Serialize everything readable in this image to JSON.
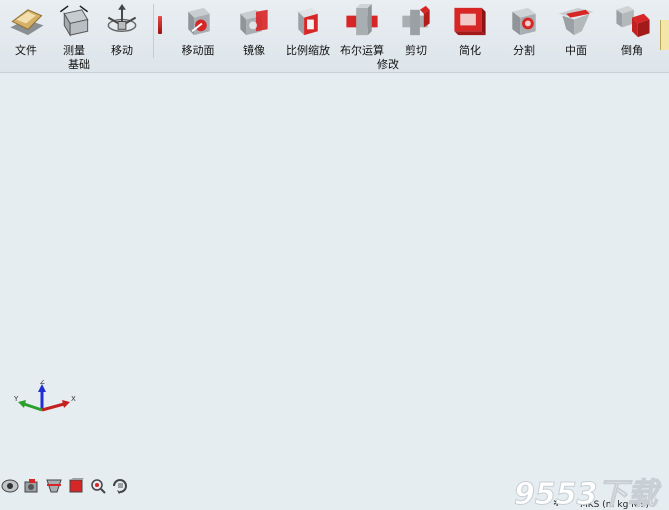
{
  "ribbon": {
    "group_basic": "基础",
    "group_modify": "修改",
    "tools_basic": [
      {
        "label": "文件",
        "icon": "file-icon"
      },
      {
        "label": "测量",
        "icon": "measure-icon"
      },
      {
        "label": "移动",
        "icon": "move-icon"
      }
    ],
    "tools_modify": [
      {
        "label": "移动面",
        "icon": "move-face-icon"
      },
      {
        "label": "镜像",
        "icon": "mirror-icon"
      },
      {
        "label": "比例缩放",
        "icon": "scale-icon"
      },
      {
        "label": "布尔运算",
        "icon": "boolean-icon"
      },
      {
        "label": "剪切",
        "icon": "cut-icon"
      },
      {
        "label": "简化",
        "icon": "simplify-icon"
      },
      {
        "label": "分割",
        "icon": "split-icon"
      },
      {
        "label": "中面",
        "icon": "midsurface-icon"
      },
      {
        "label": "倒角",
        "icon": "chamfer-icon"
      }
    ]
  },
  "axes": {
    "z": "Z",
    "x": "X",
    "y": "Y"
  },
  "bottom_tools": [
    "view-icon",
    "camera-icon",
    "section-icon",
    "shading-icon",
    "zoom-icon",
    "rotate-icon"
  ],
  "status": {
    "units": "MKS (m kg N s)"
  },
  "watermark": {
    "text": "9553下载"
  },
  "colors": {
    "accent_red": "#d72626",
    "canvas": "#e6edf1",
    "model_gray": "#9aa1a6"
  }
}
